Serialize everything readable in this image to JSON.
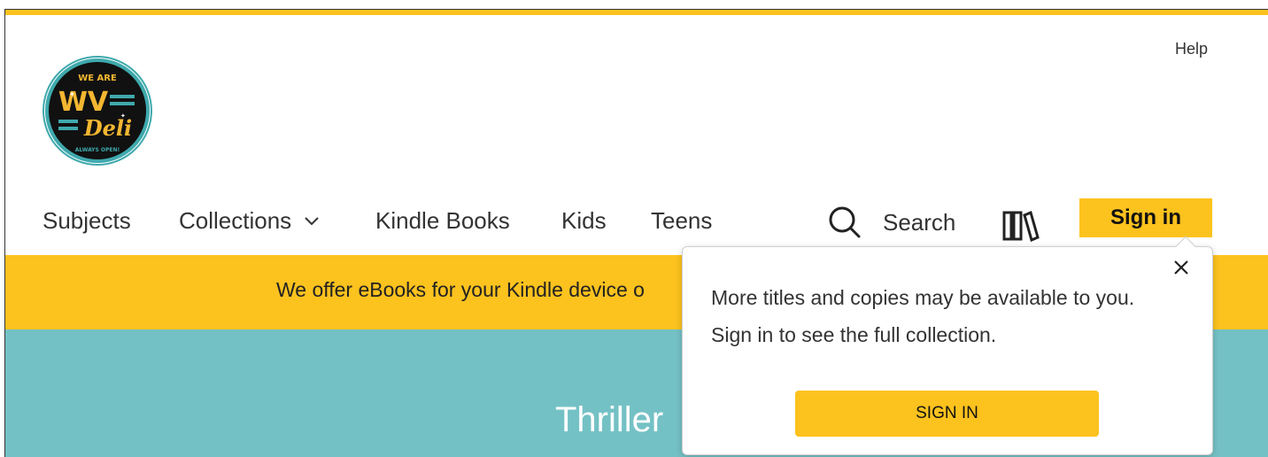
{
  "header": {
    "help_label": "Help",
    "logo": {
      "alt": "WV Deli logo",
      "top_text": "WE ARE",
      "main_text": "WV",
      "sub_text": "Deli",
      "bottom_text": "ALWAYS OPEN!"
    }
  },
  "nav": {
    "items": [
      {
        "label": "Subjects"
      },
      {
        "label": "Collections"
      },
      {
        "label": "Kindle Books"
      },
      {
        "label": "Kids"
      },
      {
        "label": "Teens"
      }
    ],
    "search_label": "Search",
    "signin_label": "Sign in"
  },
  "banner": {
    "text": "We offer eBooks for your Kindle device o"
  },
  "hero": {
    "title": "Thriller"
  },
  "popover": {
    "line1": "More titles and copies may be available to you.",
    "line2": "Sign in to see the full collection.",
    "button_label": "SIGN IN"
  },
  "colors": {
    "accent_yellow": "#fcc21e",
    "hero_teal": "#74c1c5",
    "logo_dark": "#111111",
    "logo_ring": "#3fa9ad",
    "logo_text": "#f4b731"
  }
}
